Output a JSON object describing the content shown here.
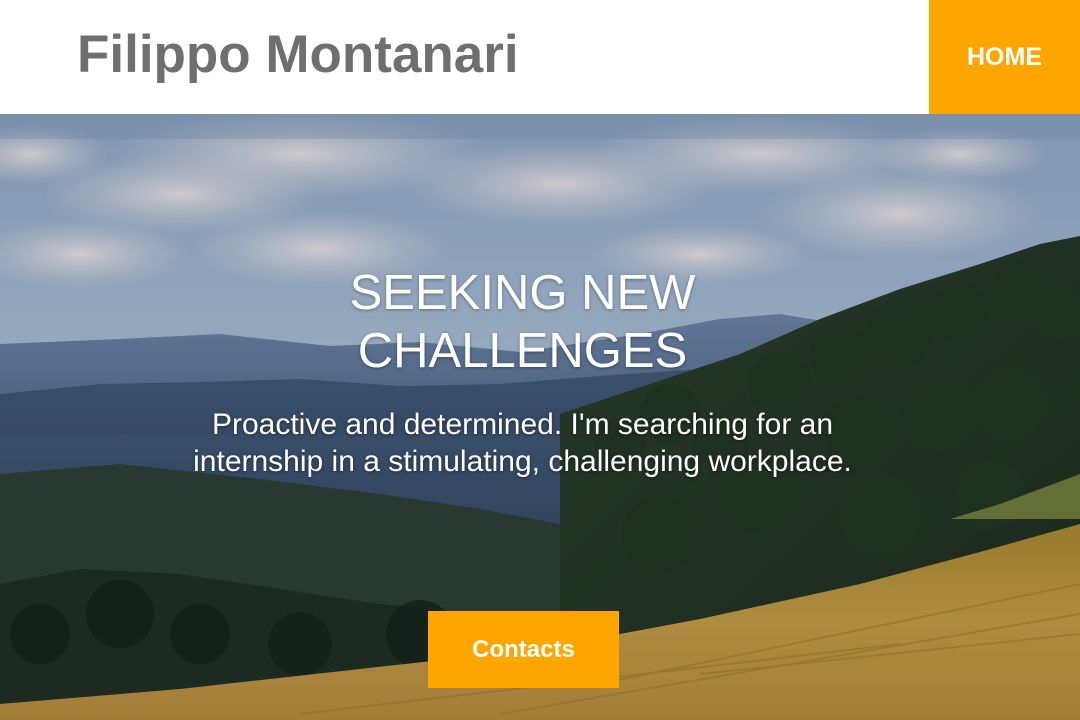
{
  "header": {
    "site_title": "Filippo Montanari",
    "nav": {
      "home_label": "HOME"
    }
  },
  "hero": {
    "background_icon": "mountain-landscape-photo",
    "heading": "SEEKING NEW CHALLENGES",
    "subtitle": "Proactive and determined. I'm searching for an internship in a stimulating, challenging workplace.",
    "cta_label": "Contacts"
  },
  "colors": {
    "accent": "#FFA500",
    "title_gray": "#6F6F6F",
    "white": "#FFFFFF"
  }
}
